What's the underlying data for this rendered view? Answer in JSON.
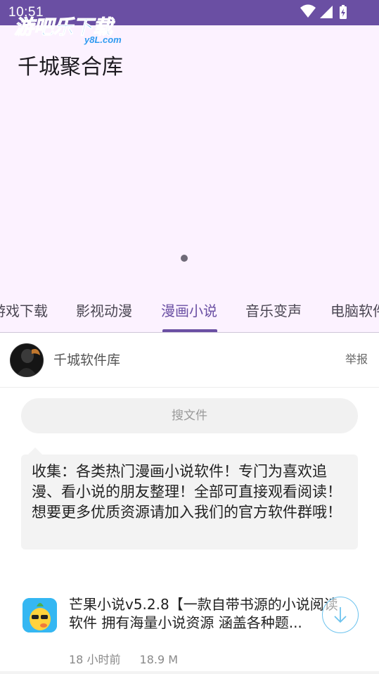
{
  "status_bar": {
    "time": "10:51"
  },
  "watermark": {
    "text": "游吧乐下载",
    "sub": "y8L.com"
  },
  "banner": {
    "title": "千城聚合库"
  },
  "tabs": [
    {
      "label": "游戏下载"
    },
    {
      "label": "影视动漫"
    },
    {
      "label": "漫画小说"
    },
    {
      "label": "音乐变声"
    },
    {
      "label": "电脑软件"
    }
  ],
  "active_tab": "漫画小说",
  "header": {
    "author": "千城软件库",
    "report": "举报"
  },
  "search": {
    "placeholder": "搜文件"
  },
  "description": "收集：各类热门漫画小说软件！专门为喜欢追漫、看小说的朋友整理！全部可直接观看阅读！想要更多优质资源请加入我们的官方软件群哦！",
  "file": {
    "title": "芒果小说v5.2.8【一款自带书源的小说阅读软件 拥有海量小说资源 涵盖各种题...",
    "time": "18 小时前",
    "size": "18.9 M"
  },
  "colors": {
    "accent": "#6a4fa3",
    "banner_bg": "#fcf2ff"
  }
}
